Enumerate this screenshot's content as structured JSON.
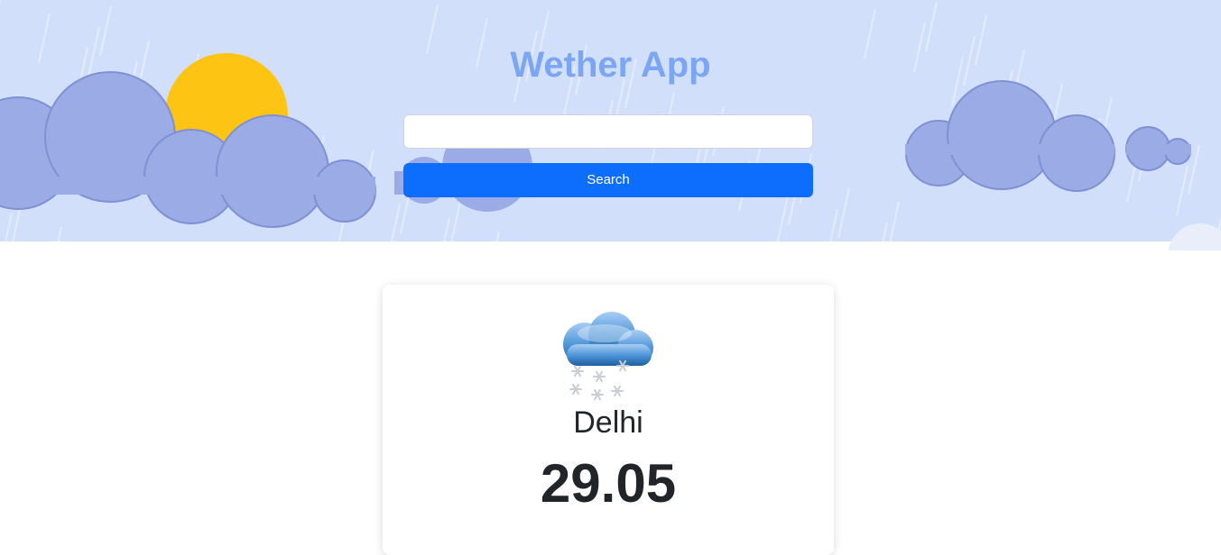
{
  "app": {
    "title": "Wether App"
  },
  "search": {
    "value": "",
    "placeholder": "",
    "button_label": "Search"
  },
  "weather": {
    "icon": "snow-cloud-icon",
    "city": "Delhi",
    "temperature": "29.05"
  },
  "colors": {
    "hero_bg": "#d2dffb",
    "title": "#7aa6f3",
    "cloud": "#9aabe6",
    "sun": "#fec413",
    "button": "#0d6efd",
    "text": "#212529"
  }
}
